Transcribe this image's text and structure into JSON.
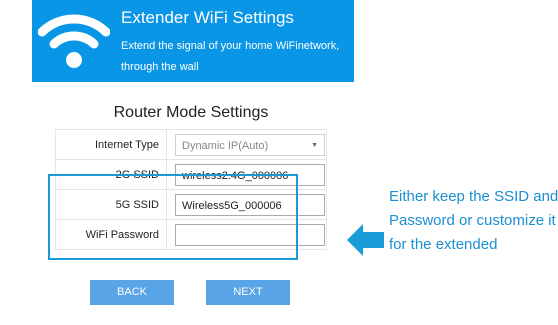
{
  "header": {
    "title": "Extender WiFi Settings",
    "subtitle": "Extend the signal of your home WiFinetwork, through the wall",
    "icon": "wifi-icon"
  },
  "form": {
    "title": "Router Mode Settings",
    "internet_type": {
      "label": "Internet Type",
      "value": "Dynamic IP(Auto)"
    },
    "ssid_2g": {
      "label": "2G SSID",
      "value": "wireless2.4G_000006"
    },
    "ssid_5g": {
      "label": "5G SSID",
      "value": "Wireless5G_000006"
    },
    "wifi_password": {
      "label": "WiFi Password",
      "value": ""
    }
  },
  "buttons": {
    "back": "BACK",
    "next": "NEXT"
  },
  "annotation": {
    "text": "Either keep the SSID and Password or customize it for the extended",
    "arrow_icon": "arrow-left-icon"
  },
  "colors": {
    "accent": "#0a96e6",
    "button": "#58a4e6",
    "annotation": "#1a8fd1"
  }
}
